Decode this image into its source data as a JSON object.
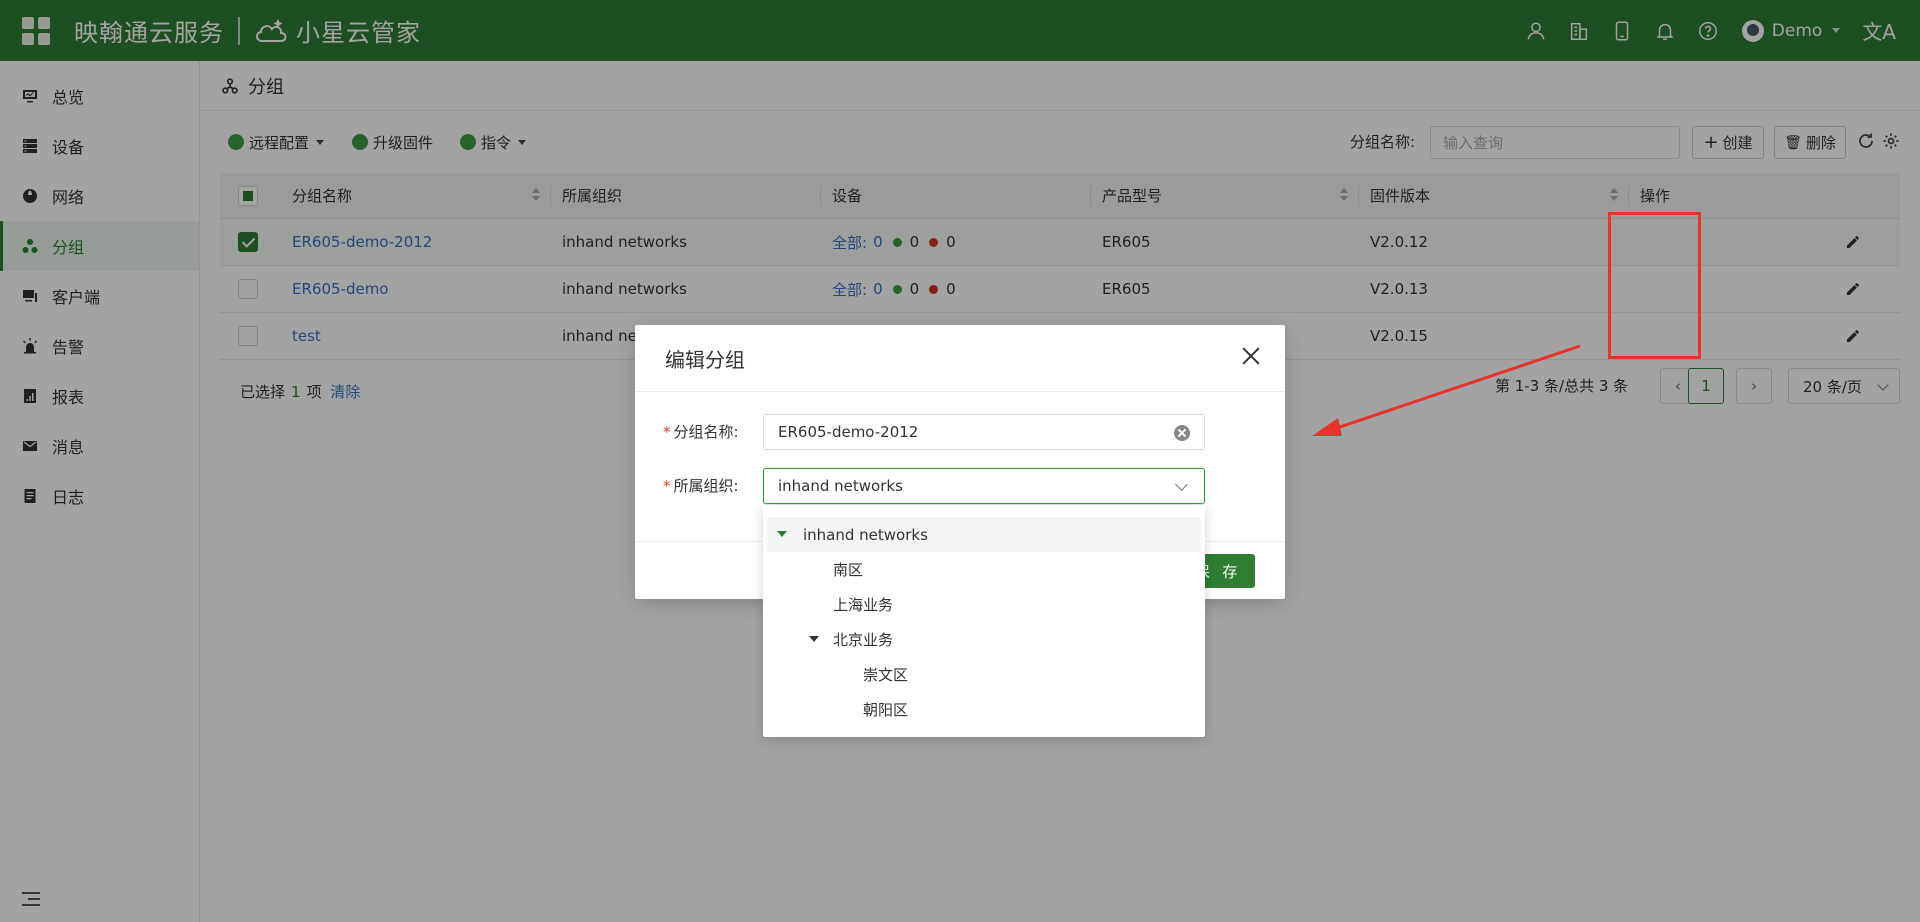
{
  "app": {
    "brand": "映翰通云服务",
    "product": "小星云管家",
    "user": "Demo",
    "lang_icon": "文A",
    "accent": "#2e7d32"
  },
  "sidebar": {
    "items": [
      {
        "label": "总览",
        "icon": "monitor-icon"
      },
      {
        "label": "设备",
        "icon": "server-icon"
      },
      {
        "label": "网络",
        "icon": "globe-icon"
      },
      {
        "label": "分组",
        "icon": "group-icon",
        "active": true
      },
      {
        "label": "客户端",
        "icon": "client-icon"
      },
      {
        "label": "告警",
        "icon": "alarm-icon"
      },
      {
        "label": "报表",
        "icon": "report-icon"
      },
      {
        "label": "消息",
        "icon": "mail-icon"
      },
      {
        "label": "日志",
        "icon": "log-icon"
      }
    ]
  },
  "page": {
    "title": "分组"
  },
  "toolbar": {
    "remote_config": "远程配置",
    "upgrade_firmware": "升级固件",
    "command": "指令",
    "search_label": "分组名称:",
    "search_placeholder": "输入查询",
    "create": "创建",
    "delete": "删除"
  },
  "table": {
    "columns": [
      "分组名称",
      "所属组织",
      "设备",
      "产品型号",
      "固件版本",
      "操作"
    ],
    "rows": [
      {
        "name": "ER605-demo-2012",
        "org": "inhand networks",
        "dev_label": "全部:",
        "dev_total": "0",
        "dev_online": "0",
        "dev_offline": "0",
        "model": "ER605",
        "firmware": "V2.0.12",
        "selected": true
      },
      {
        "name": "ER605-demo",
        "org": "inhand networks",
        "dev_label": "全部:",
        "dev_total": "0",
        "dev_online": "0",
        "dev_offline": "0",
        "model": "ER605",
        "firmware": "V2.0.13",
        "selected": false
      },
      {
        "name": "test",
        "org": "inhand ne",
        "firmware": "V2.0.15",
        "selected": false
      }
    ]
  },
  "selection": {
    "prefix": "已选择",
    "count": "1",
    "suffix": "项",
    "clear": "清除"
  },
  "pagination": {
    "total": "第 1-3 条/总共 3 条",
    "current": "1",
    "page_size": "20 条/页"
  },
  "modal": {
    "title": "编辑分组",
    "name_label": "分组名称:",
    "name_value": "ER605-demo-2012",
    "org_label": "所属组织:",
    "org_value": "inhand networks",
    "save": "保 存"
  },
  "org_tree": [
    {
      "label": "inhand networks",
      "level": 0,
      "expanded": true
    },
    {
      "label": "南区",
      "level": 1
    },
    {
      "label": "上海业务",
      "level": 1
    },
    {
      "label": "北京业务",
      "level": 1,
      "expanded": true
    },
    {
      "label": "崇文区",
      "level": 2
    },
    {
      "label": "朝阳区",
      "level": 2
    }
  ],
  "annotation": {
    "color": "#e8322d"
  }
}
